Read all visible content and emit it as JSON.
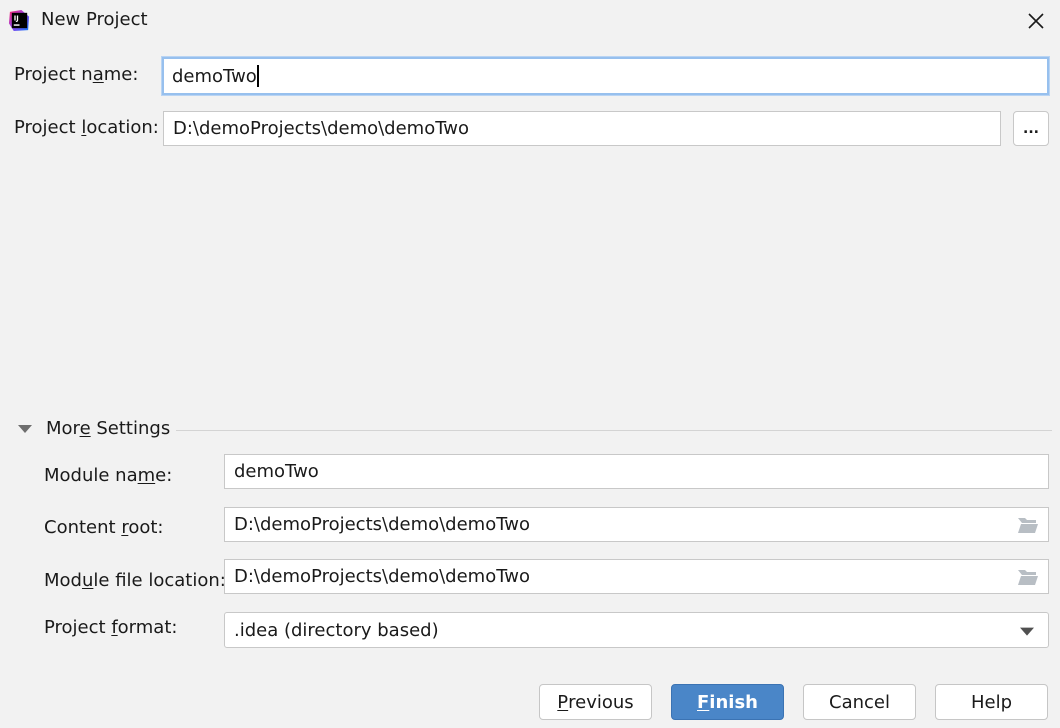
{
  "window": {
    "title": "New Project",
    "app_icon": "intellij-idea-icon",
    "close_icon": "close-icon"
  },
  "form": {
    "project_name": {
      "label_pre": "Project n",
      "label_mn": "a",
      "label_post": "me:",
      "value": "demoTwo",
      "focused": true
    },
    "project_location": {
      "label_pre": "Project ",
      "label_mn": "l",
      "label_post": "ocation:",
      "value": "D:\\demoProjects\\demo\\demoTwo",
      "browse_label": "..."
    }
  },
  "more_settings": {
    "title_pre": "Mor",
    "title_mn": "e",
    "title_post": " Settings",
    "expanded": true,
    "module_name": {
      "label_pre": "Module na",
      "label_mn": "m",
      "label_post": "e:",
      "value": "demoTwo"
    },
    "content_root": {
      "label_pre": "Content ",
      "label_mn": "r",
      "label_post": "oot:",
      "value": "D:\\demoProjects\\demo\\demoTwo"
    },
    "module_file_location": {
      "label_pre": "Mod",
      "label_mn": "u",
      "label_post": "le file location:",
      "value": "D:\\demoProjects\\demo\\demoTwo"
    },
    "project_format": {
      "label_pre": "Project ",
      "label_mn": "f",
      "label_post": "ormat:",
      "value": ".idea (directory based)"
    }
  },
  "buttons": {
    "previous": {
      "mn": "P",
      "rest": "revious"
    },
    "finish": {
      "mn": "F",
      "rest": "inish"
    },
    "cancel": "Cancel",
    "help": "Help"
  },
  "colors": {
    "primary_button": "#4a86c8",
    "focus_ring": "#97c0ee",
    "background": "#f2f2f2"
  }
}
